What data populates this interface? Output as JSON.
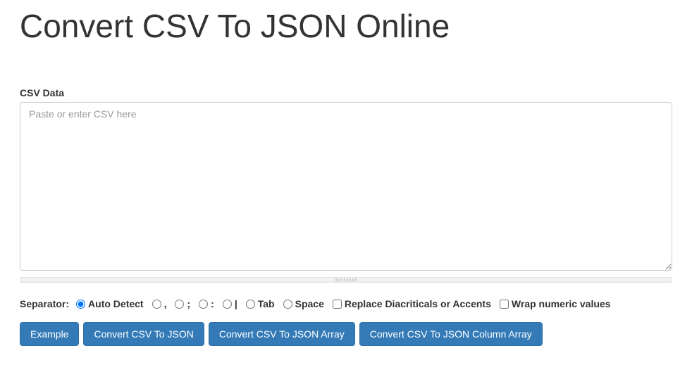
{
  "title": "Convert CSV To JSON Online",
  "csv": {
    "label": "CSV Data",
    "placeholder": "Paste or enter CSV here",
    "value": ""
  },
  "separator": {
    "label": "Separator:",
    "options": [
      {
        "value": "auto",
        "label": "Auto Detect",
        "checked": true
      },
      {
        "value": ",",
        "label": ",",
        "checked": false
      },
      {
        "value": ";",
        "label": ";",
        "checked": false
      },
      {
        "value": ":",
        "label": ":",
        "checked": false
      },
      {
        "value": "|",
        "label": "|",
        "checked": false
      },
      {
        "value": "tab",
        "label": "Tab",
        "checked": false
      },
      {
        "value": "space",
        "label": "Space",
        "checked": false
      }
    ]
  },
  "checkboxes": {
    "replaceDiacriticals": {
      "label": "Replace Diacriticals or Accents",
      "checked": false
    },
    "wrapNumeric": {
      "label": "Wrap numeric values",
      "checked": false
    }
  },
  "buttons": {
    "example": "Example",
    "toJson": "Convert CSV To JSON",
    "toJsonArray": "Convert CSV To JSON Array",
    "toJsonColArray": "Convert CSV To JSON Column Array"
  }
}
